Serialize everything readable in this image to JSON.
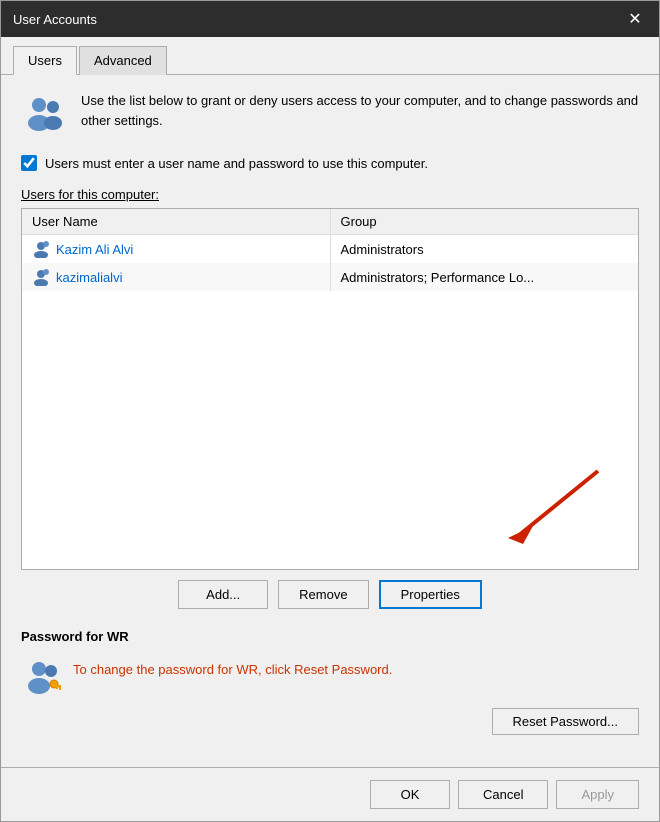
{
  "window": {
    "title": "User Accounts",
    "close_label": "✕"
  },
  "tabs": [
    {
      "id": "users",
      "label": "Users",
      "active": true
    },
    {
      "id": "advanced",
      "label": "Advanced",
      "active": false
    }
  ],
  "info_text": "Use the list below to grant or deny users access to your computer, and to change passwords and other settings.",
  "checkbox": {
    "label": "Users must enter a user name and password to use this computer.",
    "checked": true
  },
  "users_section": {
    "label": "Users for this computer:",
    "columns": [
      "User Name",
      "Group"
    ],
    "rows": [
      {
        "name": "Kazim Ali Alvi",
        "group": "Administrators"
      },
      {
        "name": "kazimalialvi",
        "group": "Administrators; Performance Lo..."
      }
    ]
  },
  "buttons": {
    "add": "Add...",
    "remove": "Remove",
    "properties": "Properties"
  },
  "password_section": {
    "title": "Password for WR",
    "text": "To change the password for WR, click Reset Password.",
    "reset_button": "Reset Password..."
  },
  "bottom_buttons": {
    "ok": "OK",
    "cancel": "Cancel",
    "apply": "Apply"
  }
}
